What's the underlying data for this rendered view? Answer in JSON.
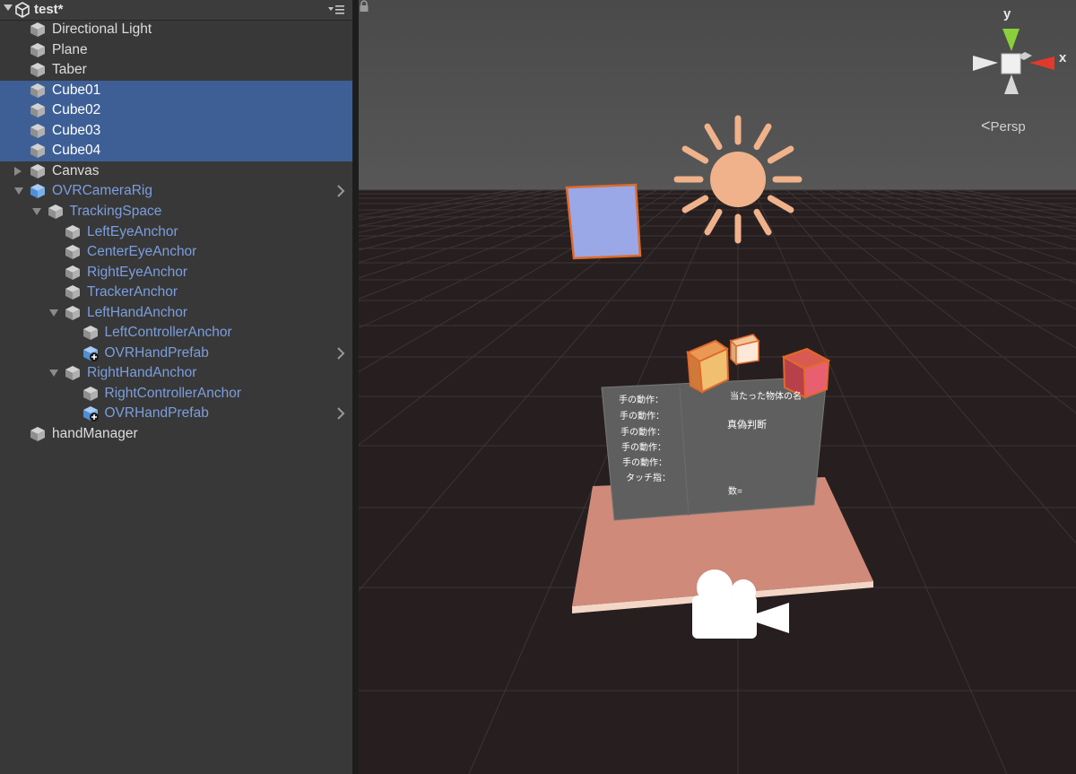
{
  "hierarchy": {
    "scene_name": "test*",
    "items": [
      {
        "label": "Directional Light"
      },
      {
        "label": "Plane"
      },
      {
        "label": "Taber"
      },
      {
        "label": "Cube01"
      },
      {
        "label": "Cube02"
      },
      {
        "label": "Cube03"
      },
      {
        "label": "Cube04"
      },
      {
        "label": "Canvas"
      },
      {
        "label": "OVRCameraRig"
      },
      {
        "label": "TrackingSpace"
      },
      {
        "label": "LeftEyeAnchor"
      },
      {
        "label": "CenterEyeAnchor"
      },
      {
        "label": "RightEyeAnchor"
      },
      {
        "label": "TrackerAnchor"
      },
      {
        "label": "LeftHandAnchor"
      },
      {
        "label": "LeftControllerAnchor"
      },
      {
        "label": "OVRHandPrefab"
      },
      {
        "label": "RightHandAnchor"
      },
      {
        "label": "RightControllerAnchor"
      },
      {
        "label": "OVRHandPrefab"
      },
      {
        "label": "handManager"
      }
    ]
  },
  "scene": {
    "gizmo": {
      "y_label": "y",
      "x_label": "x"
    },
    "projection_label": "Persp",
    "canvas_panel": {
      "lines": [
        "手の動作：",
        "手の動作：",
        "手の動作：",
        "手の動作：",
        "手の動作：",
        "タッチ指："
      ],
      "hit_label": "当たった物体の名",
      "judge_label": "真偽判断",
      "count_label": "数="
    }
  },
  "colors": {
    "selection": "#3e5f96",
    "prefab_text": "#7b9ede",
    "sun": "#f0b28a",
    "cube_blue": "#9aa8e8",
    "cube_orange": "#f0b070",
    "cube_red": "#e06070",
    "table": "#cf8a7a"
  }
}
